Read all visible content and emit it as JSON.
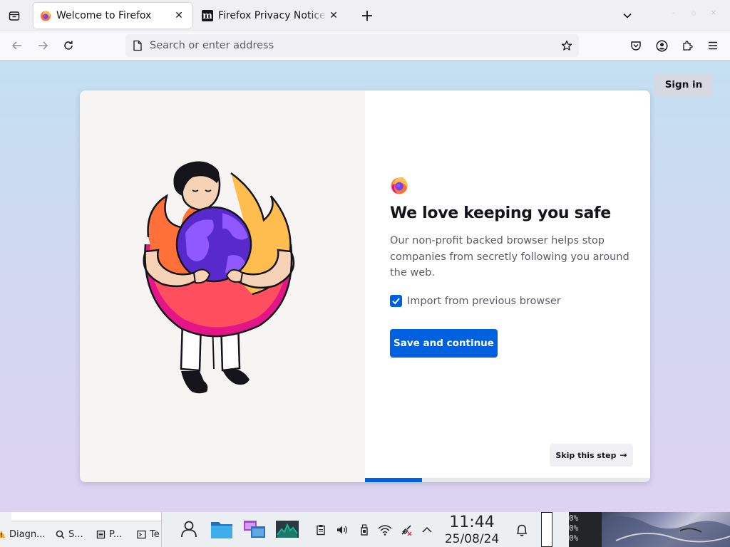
{
  "browser": {
    "tabs": [
      {
        "title": "Welcome to Firefox",
        "active": true,
        "favicon": "firefox-logo-icon"
      },
      {
        "title": "Firefox Privacy Notice — Mozilla",
        "active": false,
        "favicon": "mozilla-m-icon"
      }
    ],
    "newtab_label": "+",
    "urlbar": {
      "placeholder": "Search or enter address",
      "value": ""
    }
  },
  "page": {
    "sign_in": "Sign in",
    "headline": "We love keeping you safe",
    "subtitle": "Our non-profit backed browser helps stop companies from secretly following you around the web.",
    "import_label": "Import from previous browser",
    "import_checked": true,
    "primary_button": "Save and continue",
    "skip_button": "Skip this step",
    "skip_arrow": "→",
    "progress": 0.2
  },
  "taskbar": {
    "items": [
      {
        "label": "Diagn...",
        "icon": "warning-icon"
      },
      {
        "label": "S...",
        "icon": "search-icon"
      },
      {
        "label": "P...",
        "icon": "document-icon"
      },
      {
        "label": "Te",
        "icon": "terminal-icon"
      }
    ],
    "clock": {
      "time": "11:44",
      "date": "25/08/24"
    },
    "terminal_lines": [
      "0%",
      "0%",
      "0%"
    ]
  },
  "colors": {
    "accent": "#0061e0",
    "content_top": "#c4e0f2",
    "content_bottom": "#ddd2f2"
  }
}
